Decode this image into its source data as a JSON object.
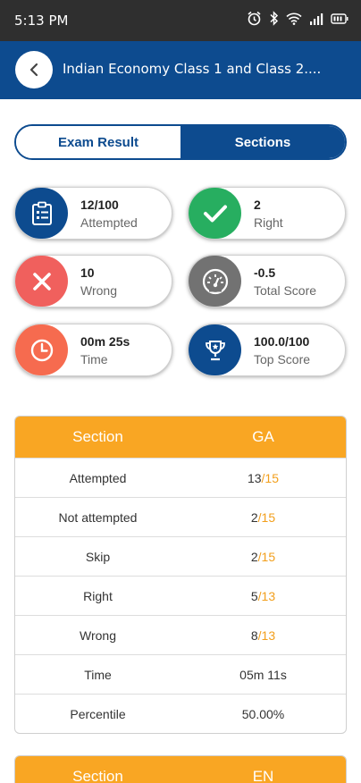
{
  "status_bar": {
    "time": "5:13 PM"
  },
  "header": {
    "title": "Indian Economy Class 1 and  Class 2...."
  },
  "tabs": [
    {
      "label": "Exam Result"
    },
    {
      "label": "Sections"
    }
  ],
  "stats": [
    {
      "value": "12/100",
      "label": "Attempted",
      "color": "#0d4b8f",
      "icon": "clipboard-icon"
    },
    {
      "value": "2",
      "label": "Right",
      "color": "#27ae60",
      "icon": "check-icon"
    },
    {
      "value": "10",
      "label": "Wrong",
      "color": "#f0605d",
      "icon": "close-icon"
    },
    {
      "value": "-0.5",
      "label": "Total Score",
      "color": "#727272",
      "icon": "speedometer-icon"
    },
    {
      "value": "00m 25s",
      "label": "Time",
      "color": "#f66b4f",
      "icon": "clock-icon"
    },
    {
      "value": "100.0/100",
      "label": "Top Score",
      "color": "#0d4b8f",
      "icon": "trophy-icon"
    }
  ],
  "sections": [
    {
      "header_label": "Section",
      "name": "GA",
      "rows": [
        {
          "label": "Attempted",
          "value": "13",
          "total": "/15"
        },
        {
          "label": "Not attempted",
          "value": "2",
          "total": "/15"
        },
        {
          "label": "Skip",
          "value": "2",
          "total": "/15"
        },
        {
          "label": "Right",
          "value": "5",
          "total": "/13"
        },
        {
          "label": "Wrong",
          "value": "8",
          "total": "/13"
        },
        {
          "label": "Time",
          "value": "05m 11s",
          "total": ""
        },
        {
          "label": "Percentile",
          "value": "50.00%",
          "total": ""
        }
      ]
    },
    {
      "header_label": "Section",
      "name": "EN",
      "rows": []
    }
  ],
  "colors": {
    "primary": "#0d4b8f",
    "accent": "#f9a623"
  }
}
